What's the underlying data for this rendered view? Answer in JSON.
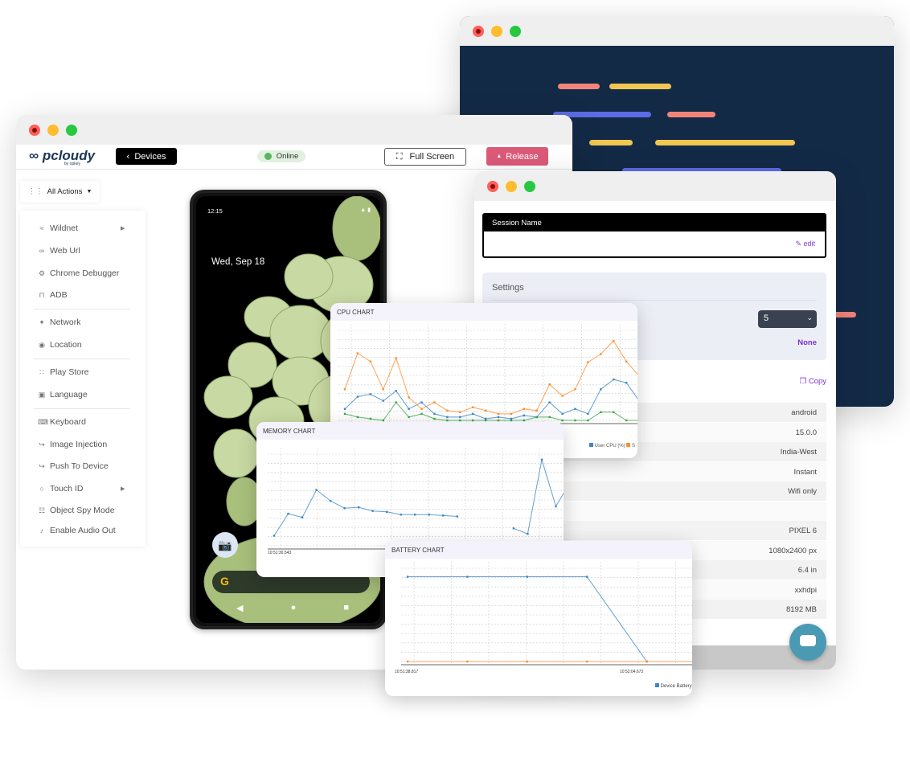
{
  "main_window": {
    "logo": "pcloudy",
    "logo_sub": "by opkey",
    "devices_label": "Devices",
    "status": "Online",
    "fullscreen_label": "Full Screen",
    "release_label": "Release",
    "all_actions": "All Actions",
    "menu": [
      {
        "label": "Wildnet",
        "icon": "wifi-icon",
        "submenu": true
      },
      {
        "label": "Web Url",
        "icon": "link-icon"
      },
      {
        "label": "Chrome Debugger",
        "icon": "bug-icon"
      },
      {
        "label": "ADB",
        "icon": "terminal-icon"
      },
      {
        "label": "Network",
        "icon": "network-icon"
      },
      {
        "label": "Location",
        "icon": "location-pin-icon"
      },
      {
        "label": "Play Store",
        "icon": "apps-icon"
      },
      {
        "label": "Language",
        "icon": "language-icon"
      },
      {
        "label": "Keyboard",
        "icon": "keyboard-icon"
      },
      {
        "label": "Image Injection",
        "icon": "import-icon"
      },
      {
        "label": "Push To Device",
        "icon": "import-icon"
      },
      {
        "label": "Touch ID",
        "icon": "fingerprint-icon",
        "submenu": true
      },
      {
        "label": "Object Spy Mode",
        "icon": "hierarchy-icon"
      },
      {
        "label": "Enable Audio Out",
        "icon": "speaker-icon"
      }
    ]
  },
  "phone": {
    "time": "12:15",
    "date": "Wed, Sep 18"
  },
  "session_window": {
    "session_name_label": "Session Name",
    "edit_label": "edit",
    "settings_label": "Settings",
    "select_value": "5",
    "none_label": "None",
    "copy_label": "Copy",
    "details": [
      "android",
      "15.0.0",
      "India-West",
      "Instant",
      "Wifi only",
      "",
      "PIXEL 6",
      "1080x2400 px",
      "6.4 in",
      "xxhdpi",
      "8192 MB"
    ]
  },
  "colors": {
    "release": "#dc5a78",
    "accent": "#7b2fd0",
    "code_bg": "#132a47",
    "blue": "#3b87c8",
    "orange": "#ff8c2a",
    "green": "#3aa84a"
  },
  "chart_data": [
    {
      "type": "line",
      "title": "CPU CHART",
      "legend": [
        "User CPU (%)",
        "S"
      ],
      "ylim": [
        0,
        110
      ],
      "series": [
        {
          "name": "User CPU (%)",
          "color": "#3b87c8",
          "values": [
            14,
            29,
            32,
            24,
            36,
            14,
            22,
            8,
            4,
            4,
            8,
            2,
            4,
            2,
            6,
            4,
            22,
            8,
            14,
            8,
            38,
            50,
            46,
            24,
            24
          ]
        },
        {
          "color": "#ff8c2a",
          "values": [
            38,
            82,
            72,
            38,
            76,
            28,
            14,
            22,
            12,
            10,
            16,
            12,
            8,
            8,
            14,
            12,
            44,
            30,
            38,
            71,
            81,
            97,
            72,
            54,
            81
          ]
        },
        {
          "color": "#3aa84a",
          "values": [
            8,
            4,
            2,
            0,
            22,
            4,
            8,
            2,
            0,
            0,
            0,
            0,
            0,
            0,
            0,
            4,
            4,
            0,
            0,
            0,
            10,
            10,
            0,
            0,
            12
          ]
        }
      ]
    },
    {
      "type": "line",
      "title": "MEMORY CHART",
      "x_tick_labels": [
        "10:51:30.543"
      ],
      "ylim": [
        0,
        100
      ],
      "series": [
        {
          "color": "#3b87c8",
          "values": [
            11,
            35,
            31,
            61,
            49,
            41,
            42,
            38,
            37,
            34,
            34,
            34,
            33,
            32,
            null,
            null,
            null,
            19,
            13,
            94,
            43,
            69
          ]
        }
      ]
    },
    {
      "type": "line",
      "title": "BATTERY CHART",
      "legend": [
        "Device Battery"
      ],
      "x_tick_labels": [
        "10:51:38.817",
        "10:52:04.673"
      ],
      "ylim": [
        0,
        110
      ],
      "series": [
        {
          "name": "Device Battery",
          "color": "#3b87c8",
          "values": [
            100,
            100,
            100,
            100,
            0
          ]
        },
        {
          "color": "#ff8c2a",
          "values": [
            0,
            0,
            0,
            0,
            0,
            0
          ]
        }
      ]
    }
  ]
}
